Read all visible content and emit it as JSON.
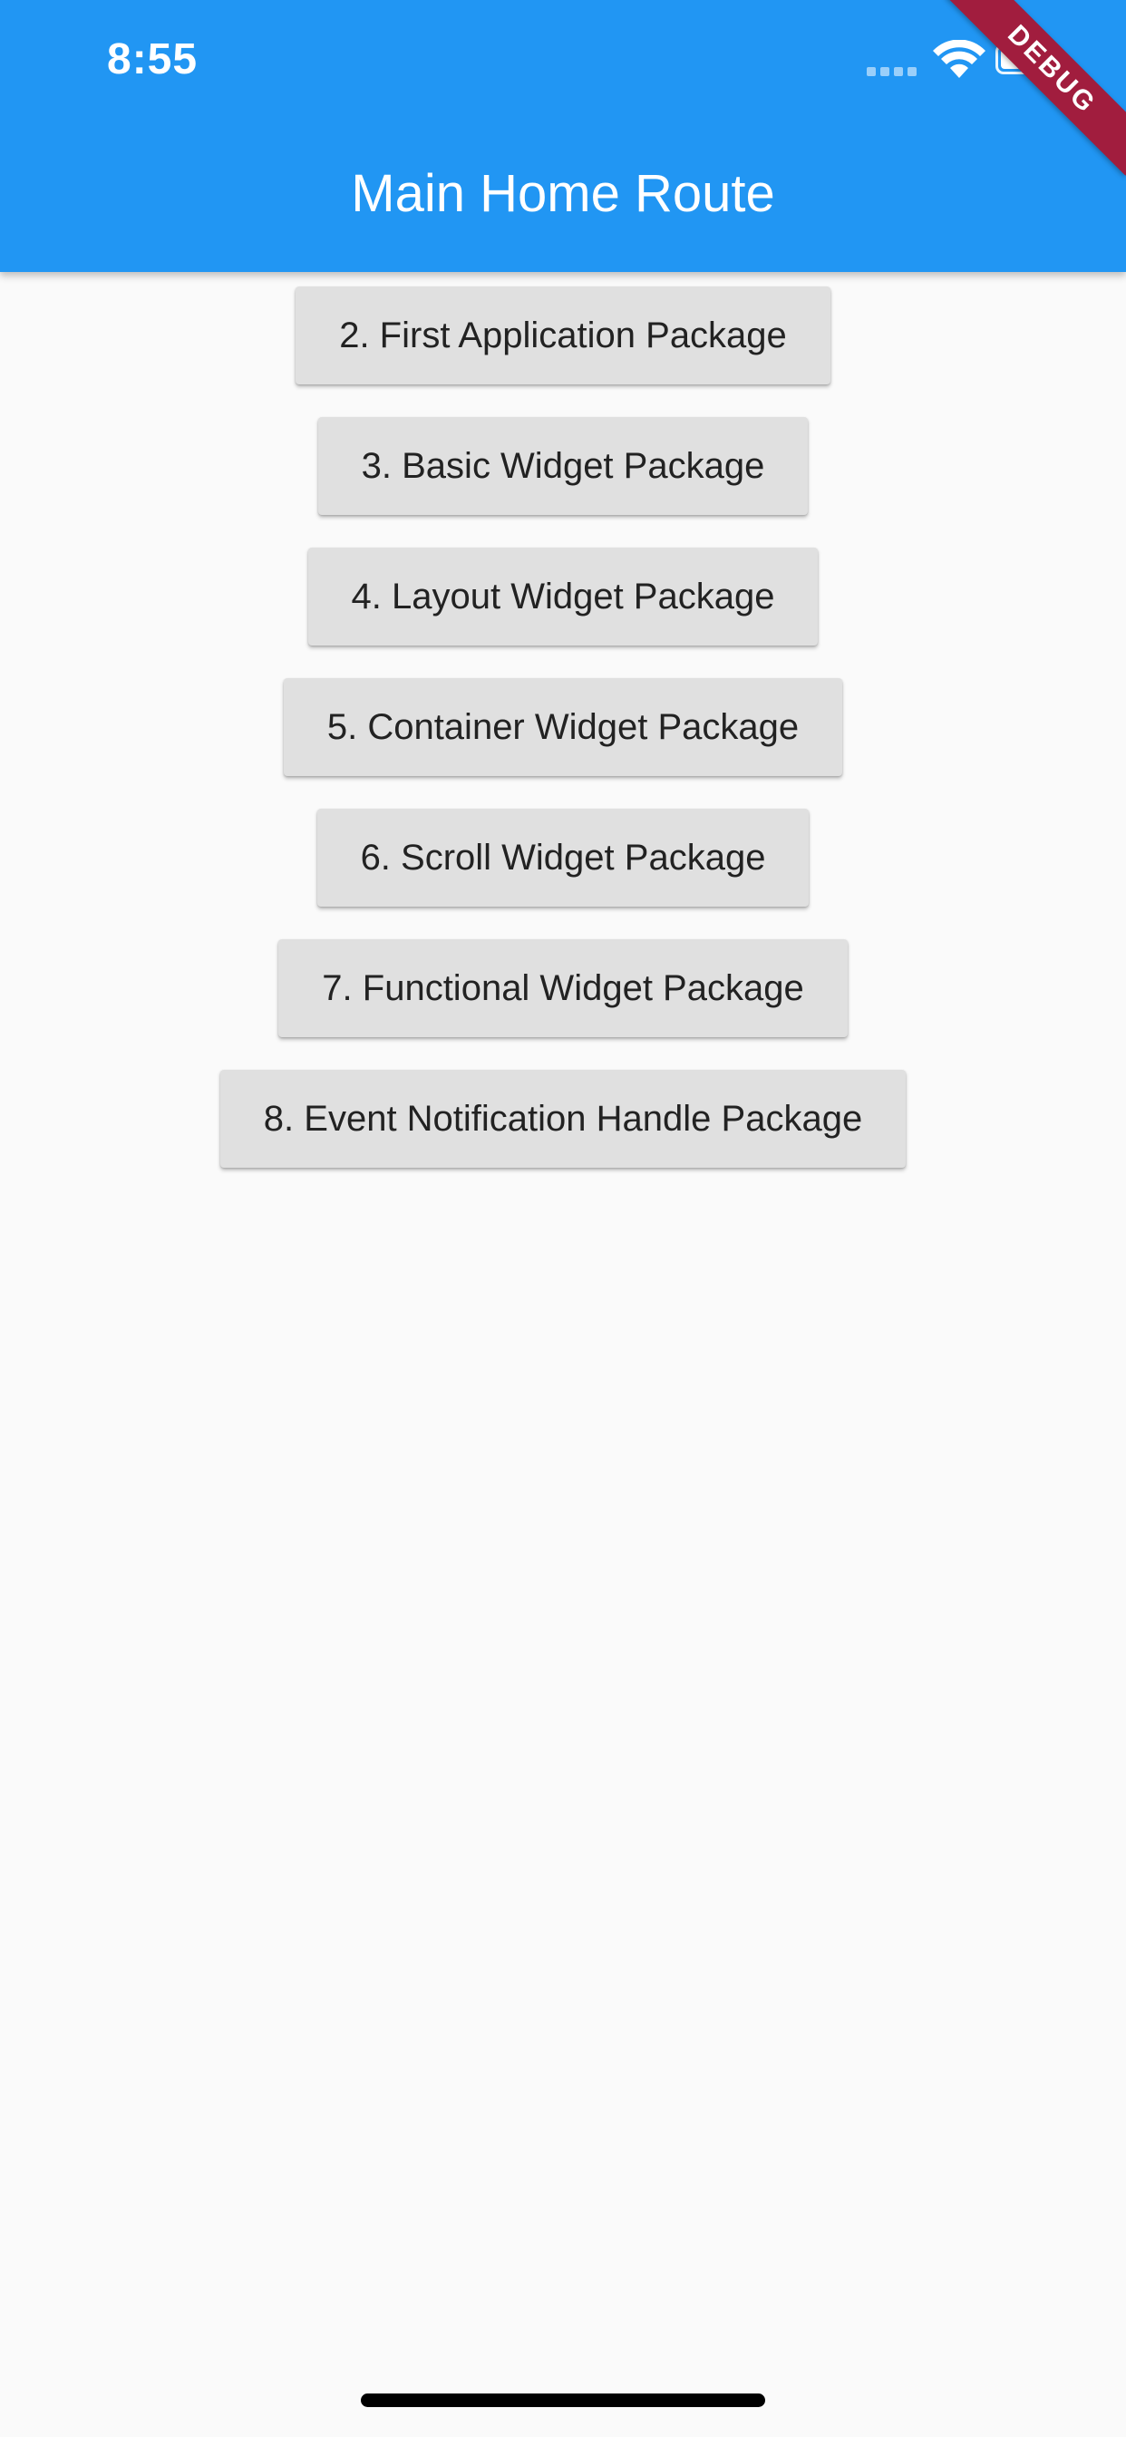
{
  "status_bar": {
    "time": "8:55",
    "icons": [
      "signal-dots-icon",
      "wifi-icon",
      "battery-icon"
    ]
  },
  "app_bar": {
    "title": "Main Home Route",
    "color": "#2196f3"
  },
  "debug_banner": {
    "label": "DEBUG",
    "color": "#a11d3e"
  },
  "buttons": [
    {
      "label": "2. First Application Package"
    },
    {
      "label": "3. Basic Widget Package"
    },
    {
      "label": "4. Layout Widget Package"
    },
    {
      "label": "5. Container Widget Package"
    },
    {
      "label": "6. Scroll Widget Package"
    },
    {
      "label": "7. Functional Widget Package"
    },
    {
      "label": "8. Event Notification Handle Package"
    }
  ],
  "colors": {
    "background": "#fafafa",
    "button_background": "#e0e0e0",
    "button_text": "#222222"
  }
}
